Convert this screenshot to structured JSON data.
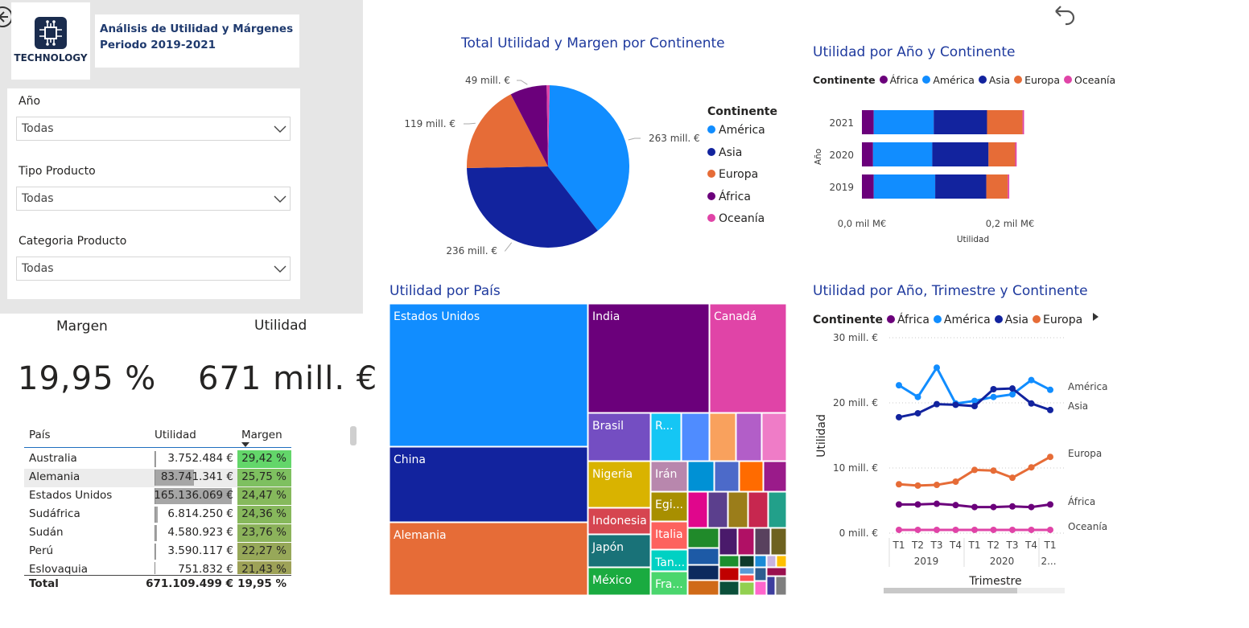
{
  "report": {
    "logo_text": "TECHNOLOGY",
    "title_line1": "Análisis de Utilidad y Márgenes",
    "title_line2": "Periodo 2019-2021"
  },
  "slicers": [
    {
      "label": "Año",
      "value": "Todas"
    },
    {
      "label": "Tipo Producto",
      "value": "Todas"
    },
    {
      "label": "Categoria Producto",
      "value": "Todas"
    }
  ],
  "kpis": {
    "margin_label": "Margen",
    "margin_value": "19,95 %",
    "profit_label": "Utilidad",
    "profit_value": "671 mill. €"
  },
  "table": {
    "headers": {
      "country": "País",
      "profit": "Utilidad",
      "margin": "Margen"
    },
    "rows": [
      {
        "country": "Australia",
        "profit": "3.752.484 €",
        "margin": "29,42 %",
        "profit_num": 3752484,
        "color": "#63d66a"
      },
      {
        "country": "Alemania",
        "profit": "83.741.341 €",
        "margin": "25,75 %",
        "profit_num": 83741341,
        "color": "#7ec060"
      },
      {
        "country": "Estados Unidos",
        "profit": "165.136.069 €",
        "margin": "24,47 %",
        "profit_num": 165136069,
        "color": "#86b95c"
      },
      {
        "country": "Sudáfrica",
        "profit": "6.814.250 €",
        "margin": "24,36 %",
        "profit_num": 6814250,
        "color": "#87b85c"
      },
      {
        "country": "Sudán",
        "profit": "4.580.923 €",
        "margin": "23,76 %",
        "profit_num": 4580923,
        "color": "#8cb35b"
      },
      {
        "country": "Perú",
        "profit": "3.590.117 €",
        "margin": "22,27 %",
        "profit_num": 3590117,
        "color": "#97a859"
      },
      {
        "country": "Eslovaquia",
        "profit": "751.832 €",
        "margin": "21,43 %",
        "profit_num": 751832,
        "color": "#9ea258"
      }
    ],
    "total": {
      "label": "Total",
      "profit": "671.109.499 €",
      "margin": "19,95 %"
    }
  },
  "colors": {
    "america": "#118dff",
    "asia": "#12239e",
    "europa": "#e66c37",
    "africa": "#6b007b",
    "oceania": "#e044a7",
    "title_blue": "#1f3a9e"
  },
  "pie": {
    "title": "Total Utilidad y Margen por Continente",
    "legend_title": "Continente",
    "legend": [
      "América",
      "Asia",
      "Europa",
      "África",
      "Oceanía"
    ],
    "labels": {
      "america": "263 mill. €",
      "asia": "236 mill. €",
      "europa": "119 mill. €",
      "africa": "49 mill. €"
    }
  },
  "bar": {
    "title": "Utilidad por Año y Continente",
    "legend_title": "Continente",
    "legend": [
      "África",
      "América",
      "Asia",
      "Europa",
      "Oceanía"
    ],
    "y_axis_label": "Año",
    "x_axis_label": "Utilidad",
    "x_ticks": [
      "0,0 mil M€",
      "0,2 mil M€"
    ],
    "years": [
      "2021",
      "2020",
      "2019"
    ]
  },
  "treemap": {
    "title": "Utilidad por País",
    "labels": [
      "Estados Unidos",
      "China",
      "Alemania",
      "India",
      "Canadá",
      "Brasil",
      "Nigeria",
      "Indonesia",
      "Japón",
      "México",
      "R...",
      "Irán",
      "Egi...",
      "Italia",
      "Tan...",
      "Fra..."
    ]
  },
  "line": {
    "title": "Utilidad por Año, Trimestre y Continente",
    "legend_title": "Continente",
    "legend": [
      "África",
      "América",
      "Asia",
      "Europa"
    ],
    "y_axis_label": "Utilidad",
    "x_axis_label": "Trimestre",
    "y_ticks": [
      "30 mill. €",
      "20 mill. €",
      "10 mill. €",
      "0 mill. €"
    ],
    "quarters": [
      "T1",
      "T2",
      "T3",
      "T4",
      "T1",
      "T2",
      "T3",
      "T4",
      "T1"
    ],
    "year_labels": [
      "2019",
      "2020",
      "2..."
    ],
    "end_labels": [
      "América",
      "Asia",
      "Europa",
      "África",
      "Oceanía"
    ]
  },
  "chart_data": [
    {
      "type": "pie",
      "title": "Total Utilidad y Margen por Continente",
      "categories": [
        "América",
        "Asia",
        "Europa",
        "África",
        "Oceanía"
      ],
      "values": [
        263,
        236,
        119,
        49,
        4
      ]
    },
    {
      "type": "bar",
      "title": "Utilidad por Año y Continente",
      "categories": [
        "2021",
        "2020",
        "2019"
      ],
      "series": [
        {
          "name": "África",
          "values": [
            0.016,
            0.015,
            0.016
          ]
        },
        {
          "name": "América",
          "values": [
            0.081,
            0.08,
            0.083
          ]
        },
        {
          "name": "Asia",
          "values": [
            0.072,
            0.076,
            0.069
          ]
        },
        {
          "name": "Europa",
          "values": [
            0.048,
            0.036,
            0.029
          ]
        },
        {
          "name": "Oceanía",
          "values": [
            0.002,
            0.002,
            0.002
          ]
        }
      ],
      "xlim": [
        0,
        0.25
      ]
    },
    {
      "type": "treemap",
      "title": "Utilidad por País",
      "categories": [
        "Estados Unidos",
        "China",
        "Alemania",
        "India",
        "Canadá"
      ],
      "values": [
        165.1,
        116,
        84,
        90,
        59
      ]
    },
    {
      "type": "line",
      "title": "Utilidad por Año, Trimestre y Continente",
      "x": [
        "2019 T1",
        "2019 T2",
        "2019 T3",
        "2019 T4",
        "2020 T1",
        "2020 T2",
        "2020 T3",
        "2020 T4",
        "2021 T1"
      ],
      "ylim": [
        0,
        30
      ],
      "series": [
        {
          "name": "América",
          "values": [
            22.7,
            20.9,
            25.4,
            19.9,
            20.3,
            20.9,
            21.3,
            23.5,
            22.0
          ]
        },
        {
          "name": "Asia",
          "values": [
            17.8,
            18.4,
            19.8,
            19.7,
            19.5,
            22.1,
            22.2,
            19.9,
            18.9
          ]
        },
        {
          "name": "Europa",
          "values": [
            7.5,
            7.3,
            7.4,
            7.9,
            9.7,
            9.6,
            8.5,
            10.1,
            11.7
          ]
        },
        {
          "name": "África",
          "values": [
            4.4,
            4.4,
            4.5,
            4.3,
            4.0,
            4.0,
            4.1,
            4.0,
            4.4
          ]
        },
        {
          "name": "Oceanía",
          "values": [
            0.5,
            0.5,
            0.5,
            0.5,
            0.5,
            0.5,
            0.5,
            0.5,
            0.5
          ]
        }
      ]
    }
  ]
}
